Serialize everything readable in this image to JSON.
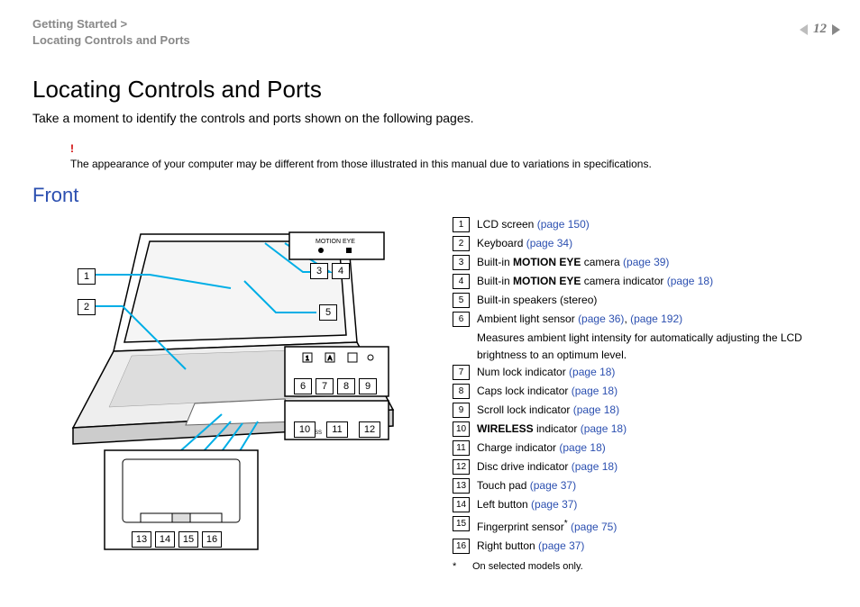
{
  "breadcrumb1": "Getting Started >",
  "breadcrumb2": "Locating Controls and Ports",
  "page_number": "12",
  "title": "Locating Controls and Ports",
  "intro": "Take a moment to identify the controls and ports shown on the following pages.",
  "note_icon": "!",
  "note": "The appearance of your computer may be different from those illustrated in this manual due to variations in specifications.",
  "section": "Front",
  "diagram_labels": {
    "motion_eye": "MOTION EYE",
    "wireless": "WIRELESS"
  },
  "legend": [
    {
      "n": "1",
      "pre": "",
      "body": "LCD screen ",
      "link": "(page 150)"
    },
    {
      "n": "2",
      "pre": "",
      "body": "Keyboard ",
      "link": "(page 34)"
    },
    {
      "n": "3",
      "pre": "Built-in ",
      "bold": "MOTION EYE",
      "body2": " camera ",
      "link": "(page 39)"
    },
    {
      "n": "4",
      "pre": "Built-in ",
      "bold": "MOTION EYE",
      "body2": " camera indicator ",
      "link": "(page 18)"
    },
    {
      "n": "5",
      "pre": "",
      "body": "Built-in speakers (stereo)",
      "link": ""
    },
    {
      "n": "6",
      "pre": "",
      "body": "Ambient light sensor ",
      "link": "(page 36)",
      "link2": "(page 192)",
      "sub": "Measures ambient light intensity for automatically adjusting the LCD brightness to an optimum level."
    },
    {
      "n": "7",
      "pre": "",
      "body": "Num lock indicator ",
      "link": "(page 18)"
    },
    {
      "n": "8",
      "pre": "",
      "body": "Caps lock indicator ",
      "link": "(page 18)"
    },
    {
      "n": "9",
      "pre": "",
      "body": "Scroll lock indicator ",
      "link": "(page 18)"
    },
    {
      "n": "10",
      "pre": "",
      "bold": "WIRELESS",
      "body2": " indicator ",
      "link": "(page 18)"
    },
    {
      "n": "11",
      "pre": "",
      "body": "Charge indicator ",
      "link": "(page 18)"
    },
    {
      "n": "12",
      "pre": "",
      "body": "Disc drive indicator ",
      "link": "(page 18)"
    },
    {
      "n": "13",
      "pre": "",
      "body": "Touch pad ",
      "link": "(page 37)"
    },
    {
      "n": "14",
      "pre": "",
      "body": "Left button ",
      "link": "(page 37)"
    },
    {
      "n": "15",
      "pre": "",
      "body": "Fingerprint sensor",
      "sup": "*",
      "body2": " ",
      "link": "(page 75)"
    },
    {
      "n": "16",
      "pre": "",
      "body": "Right button ",
      "link": "(page 37)"
    }
  ],
  "footnote_mark": "*",
  "footnote": "On selected models only."
}
